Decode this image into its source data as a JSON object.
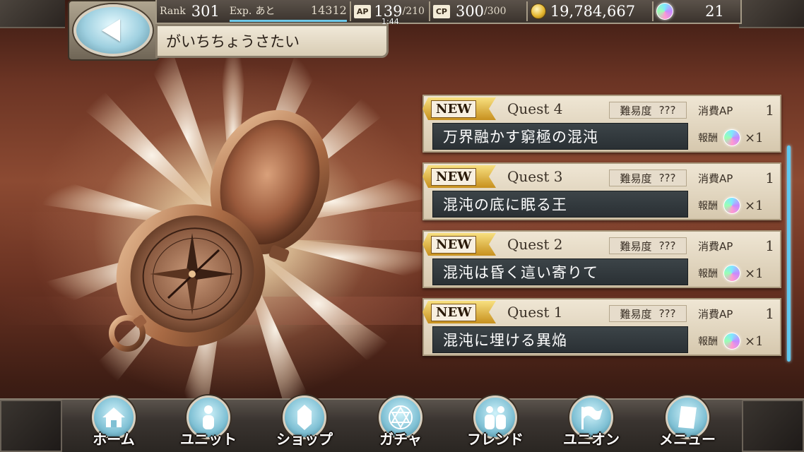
{
  "header": {
    "title": "がいちちょうさたい",
    "rank_label": "Rank",
    "rank": "301",
    "exp_label": "Exp.",
    "exp_remaining_label": "あと",
    "exp_remaining": "14312",
    "ap_label": "AP",
    "ap": "139",
    "ap_max": "/210",
    "ap_timer": "1:44",
    "cp_label": "CP",
    "cp": "300",
    "cp_max": "/300",
    "gold": "19,784,667",
    "gems": "21"
  },
  "labels": {
    "difficulty": "難易度",
    "cost": "消費AP",
    "reward": "報酬"
  },
  "quests": [
    {
      "badge": "NEW",
      "number": "Quest 4",
      "name": "万界融かす窮極の混沌",
      "difficulty": "???",
      "cost": "1",
      "reward_qty": "×1"
    },
    {
      "badge": "NEW",
      "number": "Quest 3",
      "name": "混沌の底に眠る王",
      "difficulty": "???",
      "cost": "1",
      "reward_qty": "×1"
    },
    {
      "badge": "NEW",
      "number": "Quest 2",
      "name": "混沌は昏く這い寄りて",
      "difficulty": "???",
      "cost": "1",
      "reward_qty": "×1"
    },
    {
      "badge": "NEW",
      "number": "Quest 1",
      "name": "混沌に埋ける異焔",
      "difficulty": "???",
      "cost": "1",
      "reward_qty": "×1"
    }
  ],
  "nav": [
    {
      "label": "ホーム",
      "icon": "home-icon"
    },
    {
      "label": "ユニット",
      "icon": "unit-icon"
    },
    {
      "label": "ショップ",
      "icon": "shop-icon"
    },
    {
      "label": "ガチャ",
      "icon": "gacha-icon"
    },
    {
      "label": "フレンド",
      "icon": "friend-icon"
    },
    {
      "label": "ユニオン",
      "icon": "union-icon"
    },
    {
      "label": "メニュー",
      "icon": "menu-icon"
    }
  ],
  "colors": {
    "accent_blue": "#60c8f0",
    "new_badge_gold": "#c7901e",
    "name_bar": "#2a3034"
  }
}
